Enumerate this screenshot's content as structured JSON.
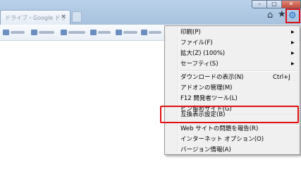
{
  "browser": {
    "tab_title": "ドライブ・Google ドラ",
    "window_controls": {
      "minimize": "–",
      "maximize": "□",
      "close": "✕"
    },
    "toolbar_icons": [
      "home-icon",
      "star-icon",
      "gear-icon"
    ],
    "accent_color": "#1b6fc7",
    "highlight_color": "#e01010"
  },
  "menu": {
    "items": [
      {
        "label": "印刷(P)",
        "submenu": true
      },
      {
        "label": "ファイル(F)",
        "submenu": true
      },
      {
        "label": "拡大(Z) (100%)",
        "submenu": true
      },
      {
        "label": "セーフティ(S)",
        "submenu": true
      },
      {
        "label": "ダウンロードの表示(N)",
        "shortcut": "Ctrl+J"
      },
      {
        "label": "アドオンの管理(M)"
      },
      {
        "label": "F12 開発者ツール(L)"
      },
      {
        "label": "ピン留めサイト(G)"
      },
      {
        "label": "互換表示設定(B)"
      },
      {
        "label": "Web サイトの問題を報告(R)"
      },
      {
        "label": "インターネット オプション(O)"
      },
      {
        "label": "バージョン情報(A)"
      }
    ],
    "arrow_glyph": "▶"
  }
}
